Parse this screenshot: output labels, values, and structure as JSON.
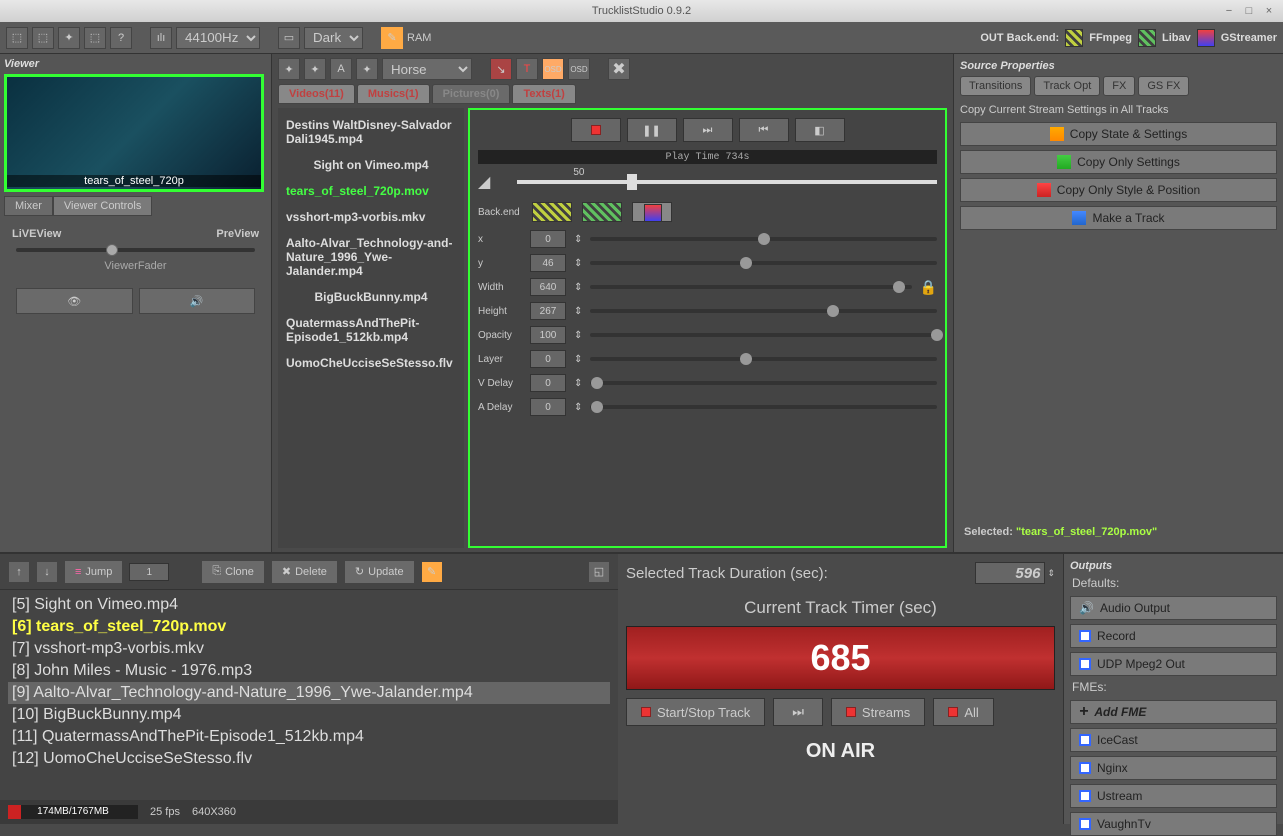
{
  "app": {
    "title": "TrucklistStudio 0.9.2"
  },
  "toolbar": {
    "sampleRate": "44100Hz",
    "theme": "Dark",
    "ram": "RAM",
    "outBackend": "OUT Back.end:",
    "ffmpeg": "FFmpeg",
    "libav": "Libav",
    "gstreamer": "GStreamer"
  },
  "viewer": {
    "title": "Viewer",
    "caption": "tears_of_steel_720p",
    "tabMixer": "Mixer",
    "tabControls": "Viewer Controls",
    "liveview": "LiVEView",
    "preview": "PreView",
    "fader": "ViewerFader"
  },
  "center": {
    "dropdown": "Horse",
    "tabs": {
      "videos": "Videos(11)",
      "musics": "Musics(1)",
      "pictures": "Pictures(0)",
      "texts": "Texts(1)"
    },
    "files": [
      "Destins WaltDisney-Salvador Dali1945.mp4",
      "Sight on Vimeo.mp4",
      "tears_of_steel_720p.mov",
      "vsshort-mp3-vorbis.mkv",
      "Aalto-Alvar_Technology-and-Nature_1996_Ywe-Jalander.mp4",
      "BigBuckBunny.mp4",
      "QuatermassAndThePit-Episode1_512kb.mp4",
      "UomoCheUcciseSeStesso.flv"
    ],
    "playtime": "Play Time 734s",
    "volume": "50",
    "backend": "Back.end",
    "props": {
      "x": {
        "label": "x",
        "value": "0",
        "pos": 50
      },
      "y": {
        "label": "y",
        "value": "46",
        "pos": 45
      },
      "width": {
        "label": "Width",
        "value": "640",
        "pos": 96
      },
      "height": {
        "label": "Height",
        "value": "267",
        "pos": 70
      },
      "opacity": {
        "label": "Opacity",
        "value": "100",
        "pos": 100
      },
      "layer": {
        "label": "Layer",
        "value": "0",
        "pos": 45
      },
      "vdelay": {
        "label": "V Delay",
        "value": "0",
        "pos": 2
      },
      "adelay": {
        "label": "A Delay",
        "value": "0",
        "pos": 2
      }
    }
  },
  "source": {
    "title": "Source Properties",
    "tabs": {
      "transitions": "Transitions",
      "trackopt": "Track Opt",
      "fx": "FX",
      "gsfx": "GS FX"
    },
    "copyLabel": "Copy Current Stream Settings in All Tracks",
    "btns": {
      "state": "Copy State & Settings",
      "settings": "Copy Only Settings",
      "style": "Copy Only Style & Position",
      "track": "Make a Track"
    },
    "selectedLabel": "Selected:",
    "selectedFile": "\"tears_of_steel_720p.mov\""
  },
  "tracks": {
    "jump": "Jump",
    "jumpN": "1",
    "clone": "Clone",
    "delete": "Delete",
    "update": "Update",
    "list": [
      "[5] Sight on Vimeo.mp4",
      "[6] tears_of_steel_720p.mov",
      "[7] vsshort-mp3-vorbis.mkv",
      "[8] John Miles - Music - 1976.mp3",
      "[9] Aalto-Alvar_Technology-and-Nature_1996_Ywe-Jalander.mp4",
      "[10] BigBuckBunny.mp4",
      "[11] QuatermassAndThePit-Episode1_512kb.mp4",
      "[12] UomoCheUcciseSeStesso.flv"
    ],
    "mem": "174MB/1767MB",
    "fps": "25 fps",
    "res": "640X360"
  },
  "timer": {
    "durLabel": "Selected Track Duration (sec):",
    "durVal": "596",
    "cttLabel": "Current Track Timer (sec)",
    "cttVal": "685",
    "startStop": "Start/Stop Track",
    "streams": "Streams",
    "all": "All",
    "onair": "ON AIR"
  },
  "outputs": {
    "title": "Outputs",
    "defaults": "Defaults:",
    "audio": "Audio Output",
    "record": "Record",
    "udp": "UDP Mpeg2 Out",
    "fmes": "FMEs:",
    "addfme": "Add FME",
    "icecast": "IceCast",
    "nginx": "Nginx",
    "ustream": "Ustream",
    "vaughn": "VaughnTv"
  }
}
